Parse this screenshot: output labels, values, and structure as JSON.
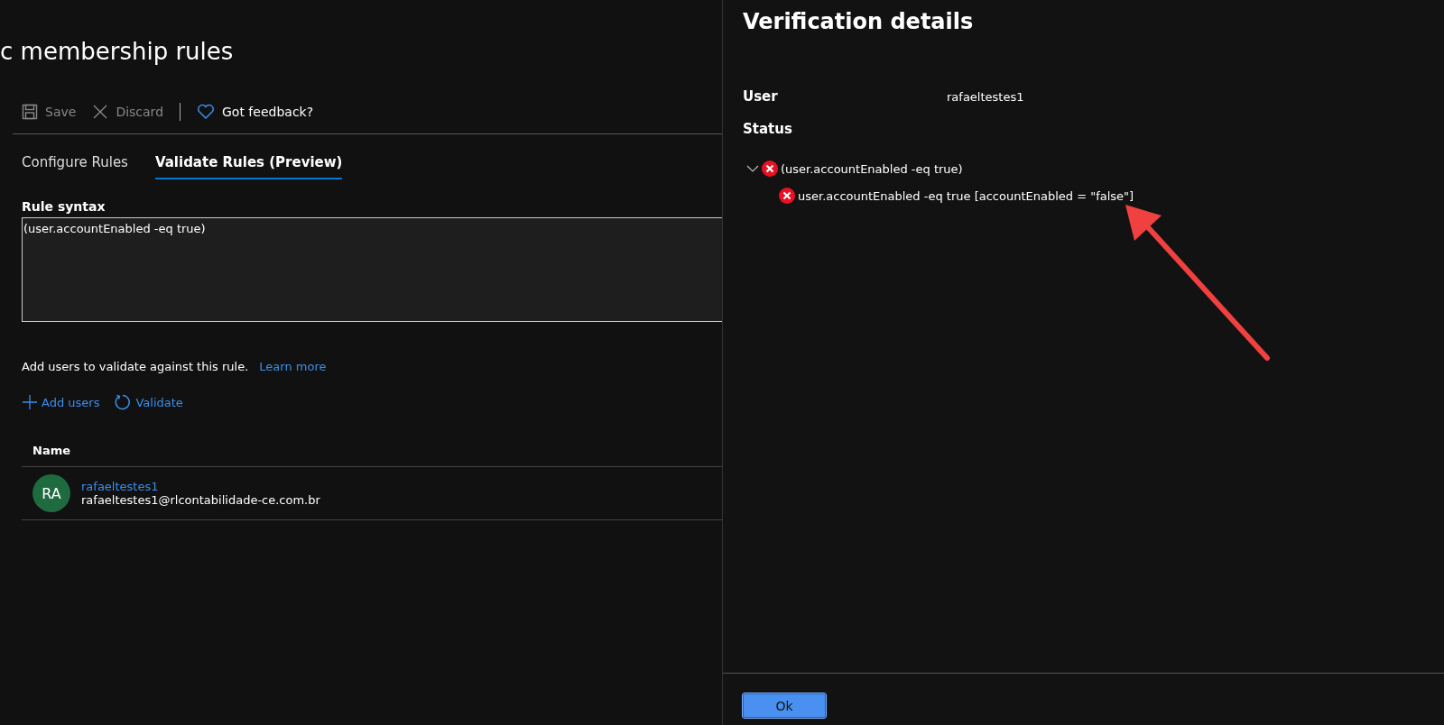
{
  "page": {
    "title": "c membership rules"
  },
  "toolbar": [
    {
      "kind": "save",
      "label": "Save",
      "disabled": true
    },
    {
      "kind": "discard",
      "label": "Discard",
      "disabled": true
    },
    {
      "kind": "feedback",
      "label": "Got feedback?",
      "disabled": false
    }
  ],
  "tabs": [
    {
      "label": "Configure Rules",
      "selected": false
    },
    {
      "label": "Validate Rules (Preview)",
      "selected": true
    }
  ],
  "rule_syntax": {
    "label": "Rule syntax",
    "value": "(user.accountEnabled -eq true)"
  },
  "validate": {
    "text": "Add users to validate against this rule.",
    "link": "Learn more",
    "actions": [
      {
        "kind": "add",
        "label": "Add users"
      },
      {
        "kind": "validate",
        "label": "Validate"
      }
    ]
  },
  "users_table": {
    "columns": [
      "Name"
    ],
    "rows": [
      {
        "initials": "RA",
        "name": "rafaeltestes1",
        "email": "rafaeltestes1@rlcontabilidade-ce.com.br"
      }
    ]
  },
  "panel": {
    "title": "Verification details",
    "user_label": "User",
    "user_value": "rafaeltestes1",
    "status_label": "Status",
    "status_tree": [
      {
        "text": "(user.accountEnabled -eq true)",
        "expanded": true,
        "children": [
          {
            "text": "user.accountEnabled -eq true [accountEnabled = \"false\"]"
          }
        ]
      }
    ],
    "ok_button": "Ok"
  }
}
